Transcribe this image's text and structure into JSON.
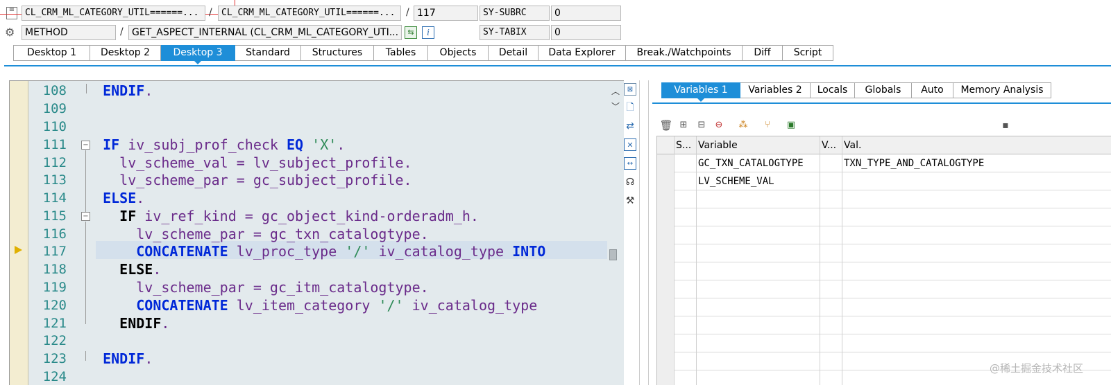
{
  "header": {
    "row1": {
      "program": "CL_CRM_ML_CATEGORY_UTIL======...",
      "include": "CL_CRM_ML_CATEGORY_UTIL======...",
      "line": "117",
      "sysfield": "SY-SUBRC",
      "sysvalue": "0",
      "sep1": "/",
      "sep2": "/"
    },
    "row2": {
      "type": "METHOD",
      "method": "GET_ASPECT_INTERNAL (CL_CRM_ML_CATEGORY_UTI...",
      "sysfield": "SY-TABIX",
      "sysvalue": "0",
      "sep": "/"
    }
  },
  "tabs": [
    "Desktop 1",
    "Desktop 2",
    "Desktop 3",
    "Standard",
    "Structures",
    "Tables",
    "Objects",
    "Detail",
    "Data Explorer",
    "Break./Watchpoints",
    "Diff",
    "Script"
  ],
  "active_tab": "Desktop 3",
  "editor": {
    "line_numbers": [
      "108",
      "109",
      "110",
      "111",
      "112",
      "113",
      "114",
      "115",
      "116",
      "117",
      "118",
      "119",
      "120",
      "121",
      "122",
      "123",
      "124"
    ],
    "current_line": "117"
  },
  "right_tabs": [
    "Variables 1",
    "Variables 2",
    "Locals",
    "Globals",
    "Auto",
    "Memory Analysis"
  ],
  "active_right_tab": "Variables 1",
  "variables": {
    "headers": {
      "s": "S...",
      "variable": "Variable",
      "v": "V...",
      "val": "Val."
    },
    "rows": [
      {
        "variable": "GC_TXN_CATALOGTYPE",
        "val": "TXN_TYPE_AND_CATALOGTYPE"
      },
      {
        "variable": "LV_SCHEME_VAL",
        "val": ""
      }
    ]
  },
  "watermark": "@稀土掘金技术社区",
  "colors": {
    "accent": "#1e8ed8",
    "keyword": "#0028d8",
    "string": "#2e8b57",
    "identifier": "#6a2b8a",
    "linenum": "#2a8a8a"
  }
}
